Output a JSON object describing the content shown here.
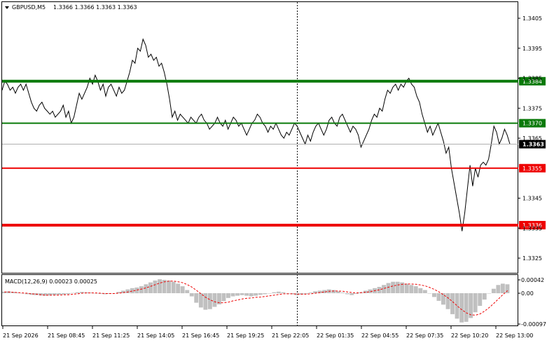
{
  "header": {
    "symbol_label": "GBPUSD,M5",
    "ohlc": "1.3366 1.3366 1.3363 1.3363"
  },
  "price_axis": {
    "ticks": [
      {
        "label": "1.3405",
        "value": 1.3405
      },
      {
        "label": "1.3395",
        "value": 1.3395
      },
      {
        "label": "1.3385",
        "value": 1.3385
      },
      {
        "label": "1.3375",
        "value": 1.3375
      },
      {
        "label": "1.3365",
        "value": 1.3365
      },
      {
        "label": "1.3345",
        "value": 1.3345
      },
      {
        "label": "1.3335",
        "value": 1.3335
      },
      {
        "label": "1.3325",
        "value": 1.3325
      }
    ],
    "current_price": {
      "label": "1.3363",
      "value": 1.3363
    }
  },
  "levels": [
    {
      "label": "1.3384",
      "value": 1.3384,
      "color": "#0a7a0a",
      "thick": true
    },
    {
      "label": "1.3370",
      "value": 1.337,
      "color": "#0a7a0a",
      "thick": false
    },
    {
      "label": "1.3355",
      "value": 1.3355,
      "color": "#ee0000",
      "thick": false
    },
    {
      "label": "1.3336",
      "value": 1.3336,
      "color": "#ee0000",
      "thick": true
    }
  ],
  "macd": {
    "label": "MACD(12,26,9) 0.00023 0.00025",
    "ticks": [
      {
        "label": "0.00042",
        "value": 0.00042
      },
      {
        "label": "0.00",
        "value": 0.0
      },
      {
        "label": "-0.00097",
        "value": -0.00097
      }
    ]
  },
  "time_axis": {
    "labels": [
      "21 Sep 2026",
      "21 Sep 08:45",
      "21 Sep 11:25",
      "21 Sep 14:05",
      "21 Sep 16:45",
      "21 Sep 19:25",
      "21 Sep 22:05",
      "22 Sep 01:35",
      "22 Sep 04:55",
      "22 Sep 07:35",
      "22 Sep 10:20",
      "22 Sep 13:00"
    ]
  },
  "colors": {
    "price_line": "#000000",
    "histogram": "#c0c0c0",
    "signal": "#ee0000",
    "grid": "#c8c8c8"
  },
  "chart_data": {
    "type": "line",
    "price": [
      1.3381,
      1.3384,
      1.3383,
      1.3381,
      1.3382,
      1.338,
      1.3382,
      1.3383,
      1.3381,
      1.3383,
      1.338,
      1.3377,
      1.3375,
      1.3374,
      1.3376,
      1.3377,
      1.3375,
      1.3374,
      1.3373,
      1.3374,
      1.3372,
      1.3373,
      1.3374,
      1.3376,
      1.3372,
      1.3374,
      1.337,
      1.3372,
      1.3376,
      1.338,
      1.3378,
      1.338,
      1.3382,
      1.3385,
      1.3383,
      1.3386,
      1.3384,
      1.3381,
      1.3383,
      1.3379,
      1.3382,
      1.3383,
      1.3381,
      1.3379,
      1.3382,
      1.338,
      1.3381,
      1.3384,
      1.3387,
      1.3391,
      1.339,
      1.3395,
      1.3394,
      1.3398,
      1.3396,
      1.3392,
      1.3393,
      1.3391,
      1.3392,
      1.3389,
      1.339,
      1.3387,
      1.3383,
      1.3378,
      1.3372,
      1.3374,
      1.3371,
      1.3373,
      1.3372,
      1.3371,
      1.337,
      1.3372,
      1.3371,
      1.337,
      1.3372,
      1.3373,
      1.3371,
      1.337,
      1.3368,
      1.3369,
      1.337,
      1.3372,
      1.337,
      1.3369,
      1.3371,
      1.3368,
      1.337,
      1.3372,
      1.3371,
      1.3369,
      1.337,
      1.3368,
      1.3366,
      1.3368,
      1.337,
      1.3371,
      1.3373,
      1.3372,
      1.337,
      1.3369,
      1.3367,
      1.3369,
      1.3368,
      1.337,
      1.3368,
      1.3366,
      1.3365,
      1.3367,
      1.3366,
      1.3368,
      1.337,
      1.3369,
      1.3367,
      1.3365,
      1.3363,
      1.3366,
      1.3364,
      1.3367,
      1.3369,
      1.337,
      1.3368,
      1.3366,
      1.3368,
      1.3371,
      1.3372,
      1.337,
      1.3369,
      1.3372,
      1.3373,
      1.3371,
      1.3369,
      1.3367,
      1.3369,
      1.3368,
      1.3366,
      1.3362,
      1.3364,
      1.3366,
      1.3368,
      1.3371,
      1.3373,
      1.3372,
      1.3375,
      1.3374,
      1.3378,
      1.3381,
      1.338,
      1.3382,
      1.3383,
      1.3381,
      1.3383,
      1.3382,
      1.3384,
      1.3385,
      1.3383,
      1.3382,
      1.3379,
      1.3377,
      1.3373,
      1.337,
      1.3367,
      1.3369,
      1.3366,
      1.3368,
      1.337,
      1.3367,
      1.3364,
      1.336,
      1.3362,
      1.3355,
      1.335,
      1.3345,
      1.334,
      1.3334,
      1.334,
      1.3348,
      1.3356,
      1.3349,
      1.3355,
      1.3352,
      1.3356,
      1.3357,
      1.3356,
      1.3358,
      1.3363,
      1.3369,
      1.3367,
      1.3363,
      1.3365,
      1.3368,
      1.3366,
      1.3363
    ],
    "macd_hist": [
      5e-05,
      6e-05,
      4e-05,
      2e-05,
      0.0,
      -3e-05,
      -5e-05,
      -6e-05,
      -7e-05,
      -8e-05,
      -7e-05,
      -6e-05,
      -5e-05,
      -4e-05,
      -3e-05,
      1e-05,
      3e-05,
      4e-05,
      3e-05,
      2e-05,
      0.0,
      -2e-05,
      -3e-05,
      -2e-05,
      0.0,
      4e-05,
      8e-05,
      0.00012,
      0.00016,
      0.00018,
      0.00022,
      0.00028,
      0.00034,
      0.0004,
      0.00044,
      0.00042,
      0.0004,
      0.00036,
      0.0003,
      0.00022,
      0.0001,
      -0.0001,
      -0.0003,
      -0.00045,
      -0.00052,
      -0.0005,
      -0.00043,
      -0.00035,
      -0.00025,
      -0.00015,
      -0.0001,
      -8e-05,
      -6e-05,
      -8e-05,
      -0.0001,
      -8e-05,
      -5e-05,
      -3e-05,
      0.0,
      3e-05,
      5e-05,
      3e-05,
      0.0,
      -3e-05,
      -6e-05,
      -4e-05,
      -2e-05,
      2e-05,
      6e-05,
      8e-05,
      0.0001,
      0.00012,
      0.0001,
      6e-05,
      2e-05,
      -3e-05,
      -6e-05,
      -2e-05,
      3e-05,
      8e-05,
      0.00012,
      0.00016,
      0.0002,
      0.00026,
      0.00032,
      0.00036,
      0.00036,
      0.00034,
      0.0003,
      0.00026,
      0.00022,
      0.00016,
      0.0001,
      0.0,
      -0.00012,
      -0.00024,
      -0.00036,
      -0.0005,
      -0.00066,
      -0.0008,
      -0.00092,
      -0.0009,
      -0.00078,
      -0.0006,
      -0.0004,
      -0.0002,
      0.0,
      0.00014,
      0.00026,
      0.0003,
      0.00028
    ],
    "macd_signal": [
      4e-05,
      4e-05,
      3e-05,
      2e-05,
      1e-05,
      0.0,
      -2e-05,
      -3e-05,
      -5e-05,
      -6e-05,
      -6e-05,
      -6e-05,
      -6e-05,
      -5e-05,
      -5e-05,
      -3e-05,
      -2e-05,
      0.0,
      1e-05,
      1e-05,
      1e-05,
      0.0,
      -1e-05,
      -1e-05,
      -1e-05,
      0.0,
      2e-05,
      4e-05,
      7e-05,
      0.0001,
      0.00013,
      0.00017,
      0.00022,
      0.00027,
      0.00032,
      0.00036,
      0.00038,
      0.00038,
      0.00036,
      0.00033,
      0.00027,
      0.00019,
      9e-05,
      -2e-05,
      -0.00013,
      -0.00021,
      -0.00027,
      -0.0003,
      -0.0003,
      -0.00028,
      -0.00024,
      -0.00021,
      -0.00018,
      -0.00016,
      -0.00015,
      -0.00013,
      -0.00012,
      -0.0001,
      -8e-05,
      -6e-05,
      -4e-05,
      -2e-05,
      -2e-05,
      -2e-05,
      -3e-05,
      -3e-05,
      -3e-05,
      -2e-05,
      0.0,
      2e-05,
      4e-05,
      6e-05,
      7e-05,
      7e-05,
      6e-05,
      4e-05,
      2e-05,
      1e-05,
      2e-05,
      3e-05,
      5e-05,
      8e-05,
      0.00011,
      0.00015,
      0.00019,
      0.00023,
      0.00026,
      0.00028,
      0.00029,
      0.00029,
      0.00028,
      0.00026,
      0.00023,
      0.00018,
      0.00012,
      4e-05,
      -5e-05,
      -0.00015,
      -0.00027,
      -0.0004,
      -0.00052,
      -0.00062,
      -0.00068,
      -0.00069,
      -0.00065,
      -0.00056,
      -0.00045,
      -0.00032,
      -0.00018,
      -4e-05,
      8e-05
    ]
  }
}
